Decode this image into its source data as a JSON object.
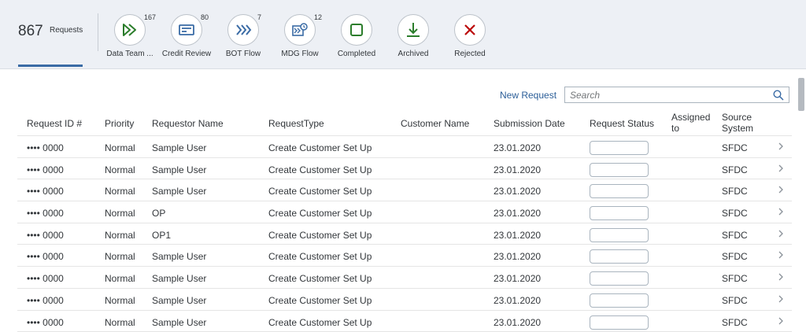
{
  "header": {
    "count": "867",
    "count_label": "Requests",
    "filters": [
      {
        "caption": "Data Team ...",
        "badge": "167",
        "icon": "double-play-icon",
        "color": "#2b7d2b"
      },
      {
        "caption": "Credit Review",
        "badge": "80",
        "icon": "credit-card-icon",
        "color": "#3a6ba5"
      },
      {
        "caption": "BOT Flow",
        "badge": "7",
        "icon": "triple-chevron-icon",
        "color": "#3a6ba5"
      },
      {
        "caption": "MDG Flow",
        "badge": "12",
        "icon": "workflow-clock-icon",
        "color": "#3a6ba5"
      },
      {
        "caption": "Completed",
        "badge": "",
        "icon": "square-icon",
        "color": "#2b7d2b"
      },
      {
        "caption": "Archived",
        "badge": "",
        "icon": "download-icon",
        "color": "#2b7d2b"
      },
      {
        "caption": "Rejected",
        "badge": "",
        "icon": "x-icon",
        "color": "#bb0000"
      }
    ]
  },
  "toolbar": {
    "new_request": "New Request",
    "search_placeholder": "Search"
  },
  "table": {
    "columns": [
      {
        "label": "Request ID #"
      },
      {
        "label": "Priority"
      },
      {
        "label": "Requestor Name"
      },
      {
        "label": "RequestType"
      },
      {
        "label": "Customer Name"
      },
      {
        "label": "Submission Date"
      },
      {
        "label": "Request Status"
      },
      {
        "label": "Assigned to"
      },
      {
        "label": "Source System"
      }
    ],
    "rows": [
      {
        "id": "•••• 0000",
        "priority": "Normal",
        "requestor": "Sample User",
        "type": "Create Customer Set Up",
        "customer": "",
        "date": "23.01.2020",
        "assigned": "",
        "source": "SFDC"
      },
      {
        "id": "•••• 0000",
        "priority": "Normal",
        "requestor": "Sample User",
        "type": "Create Customer Set Up",
        "customer": "",
        "date": "23.01.2020",
        "assigned": "",
        "source": "SFDC"
      },
      {
        "id": "•••• 0000",
        "priority": "Normal",
        "requestor": "Sample User",
        "type": "Create Customer Set Up",
        "customer": "",
        "date": "23.01.2020",
        "assigned": "",
        "source": "SFDC"
      },
      {
        "id": "•••• 0000",
        "priority": "Normal",
        "requestor": "OP",
        "type": "Create Customer Set Up",
        "customer": "",
        "date": "23.01.2020",
        "assigned": "",
        "source": "SFDC"
      },
      {
        "id": "•••• 0000",
        "priority": "Normal",
        "requestor": "OP1",
        "type": "Create Customer Set Up",
        "customer": "",
        "date": "23.01.2020",
        "assigned": "",
        "source": "SFDC"
      },
      {
        "id": "•••• 0000",
        "priority": "Normal",
        "requestor": "Sample User",
        "type": "Create Customer Set Up",
        "customer": "",
        "date": "23.01.2020",
        "assigned": "",
        "source": "SFDC"
      },
      {
        "id": "•••• 0000",
        "priority": "Normal",
        "requestor": "Sample User",
        "type": "Create Customer Set Up",
        "customer": "",
        "date": "23.01.2020",
        "assigned": "",
        "source": "SFDC"
      },
      {
        "id": "•••• 0000",
        "priority": "Normal",
        "requestor": "Sample User",
        "type": "Create Customer Set Up",
        "customer": "",
        "date": "23.01.2020",
        "assigned": "",
        "source": "SFDC"
      },
      {
        "id": "•••• 0000",
        "priority": "Normal",
        "requestor": "Sample User",
        "type": "Create Customer Set Up",
        "customer": "",
        "date": "23.01.2020",
        "assigned": "",
        "source": "SFDC"
      }
    ]
  }
}
